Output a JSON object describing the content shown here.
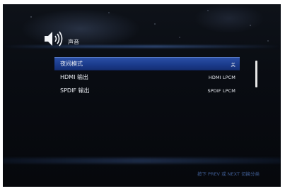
{
  "header": {
    "title": "声音",
    "icon": "speaker-icon"
  },
  "menu": {
    "items": [
      {
        "label": "夜间模式",
        "value": "关",
        "selected": true
      },
      {
        "label": "HDMI 输出",
        "value": "HDMI LPCM",
        "selected": false
      },
      {
        "label": "SPDIF 输出",
        "value": "SPDIF LPCM",
        "selected": false
      }
    ]
  },
  "footer": {
    "hint": "按下 PREV 或 NEXT 切换分类"
  },
  "colors": {
    "selection": "#1f428f",
    "text": "#e9ecf2",
    "hint": "#3f5d94",
    "background": "#090c12"
  }
}
